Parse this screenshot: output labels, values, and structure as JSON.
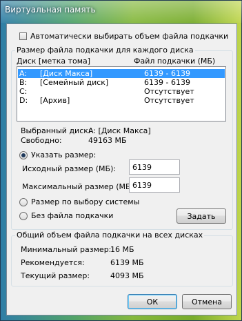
{
  "window": {
    "title": "Виртуальная память"
  },
  "auto_manage": {
    "label": "Автоматически выбирать объем файла подкачки",
    "checked": false
  },
  "per_drive": {
    "group_label": "Размер файла подкачки для каждого диска",
    "columns": {
      "drive": "Диск [метка тома]",
      "paging": "Файл подкачки (МБ)"
    },
    "drives": [
      {
        "letter": "A:",
        "label": "[Диск Макса]",
        "paging": "6139 - 6139",
        "selected": true
      },
      {
        "letter": "B:",
        "label": "[Семейный диск]",
        "paging": "6139 - 6139",
        "selected": false
      },
      {
        "letter": "C:",
        "label": "",
        "paging": "Отсутствует",
        "selected": false
      },
      {
        "letter": "D:",
        "label": "[Архив]",
        "paging": "Отсутствует",
        "selected": false
      }
    ],
    "selected_drive_label": "Выбранный диск:",
    "selected_drive_value": "A:  [Диск Макса]",
    "free_label": "Свободно:",
    "free_value": "49163 МБ",
    "custom_size": {
      "label": "Указать размер:",
      "selected": true
    },
    "initial_label": "Исходный размер (МБ):",
    "initial_value": "6139",
    "max_label": "Максимальный размер (МБ):",
    "max_value": "6139",
    "system_managed": {
      "label": "Размер по выбору системы",
      "selected": false
    },
    "no_paging": {
      "label": "Без файла подкачки",
      "selected": false
    },
    "set_button": "Задать"
  },
  "totals": {
    "group_label": "Общий объем файла подкачки на всех дисках",
    "min_label": "Минимальный размер:",
    "min_value": "16 МБ",
    "recommended_label": "Рекомендуется:",
    "recommended_value": "6139 МБ",
    "current_label": "Текущий размер:",
    "current_value": "4093 МБ"
  },
  "buttons": {
    "ok": "ОК",
    "cancel": "Отмена"
  }
}
